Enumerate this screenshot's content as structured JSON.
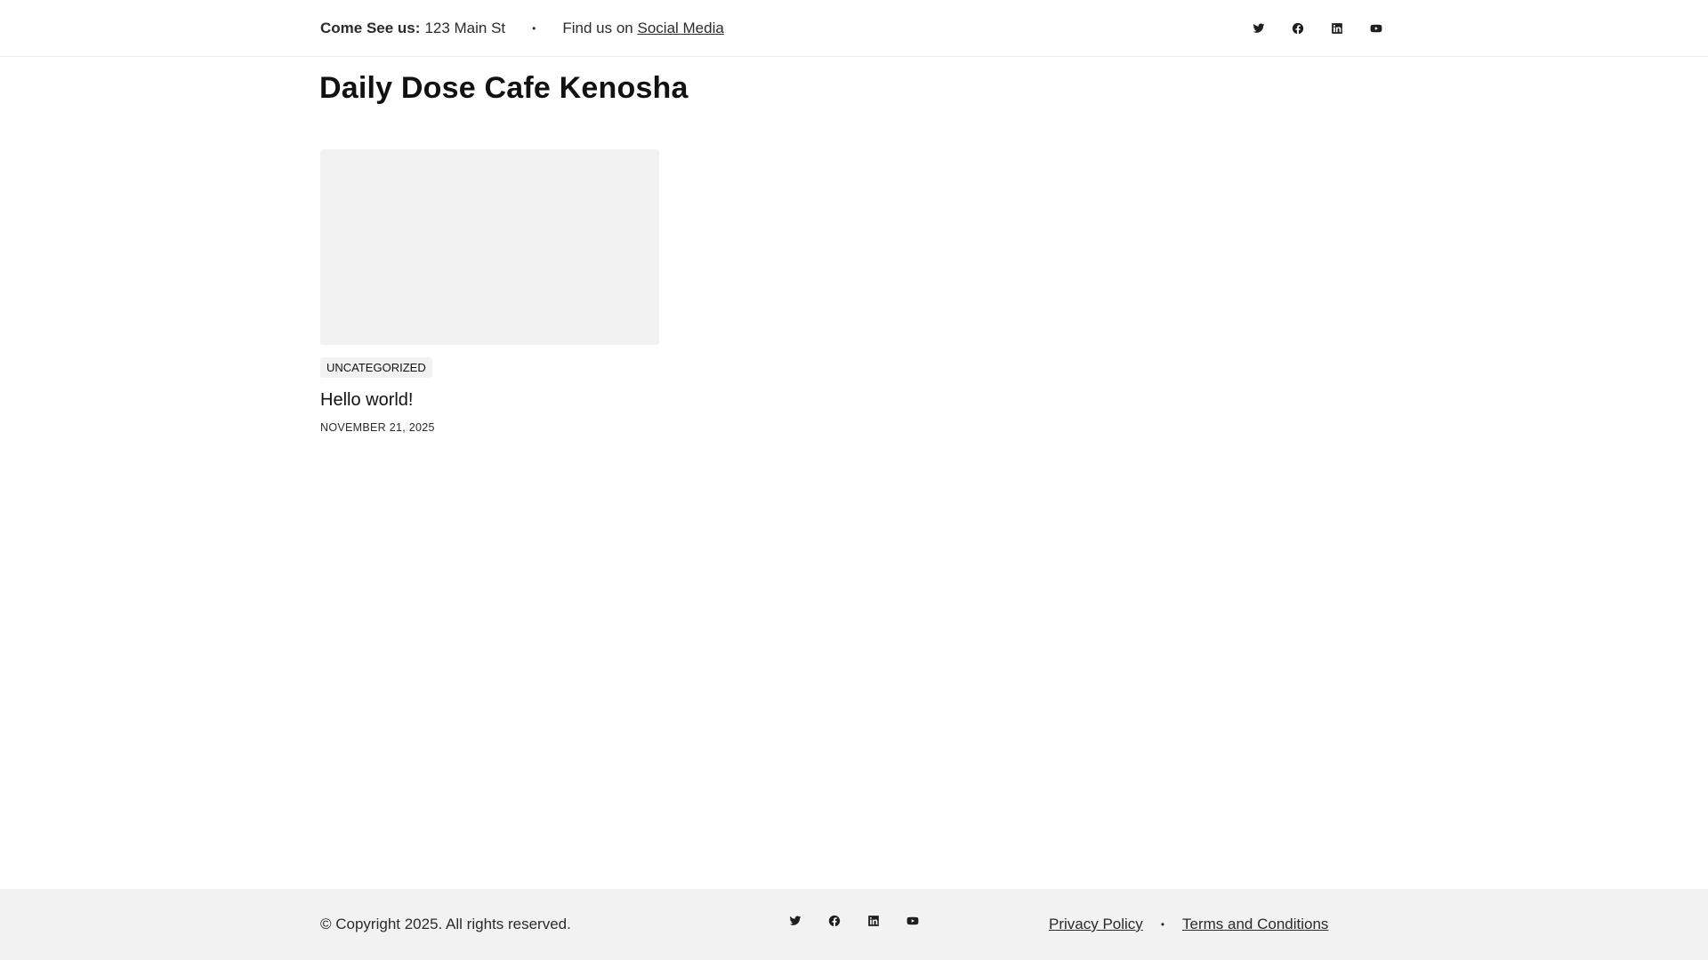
{
  "topbar": {
    "visit_label": "Come See us:",
    "address": "123 Main St",
    "separator": "•",
    "find_prefix": "Find us on",
    "social_link": "Social Media",
    "icons": [
      "twitter-icon",
      "facebook-icon",
      "linkedin-icon",
      "youtube-icon"
    ]
  },
  "site": {
    "title": "Daily Dose Cafe Kenosha"
  },
  "posts": [
    {
      "category": "UNCATEGORIZED",
      "title": "Hello world!",
      "date": "NOVEMBER 21, 2025"
    }
  ],
  "footer": {
    "copyright": "© Copyright 2025. All rights reserved.",
    "icons": [
      "twitter-icon",
      "facebook-icon",
      "linkedin-icon",
      "youtube-icon"
    ],
    "privacy_link": "Privacy Policy",
    "separator": "•",
    "terms_link": "Terms and Conditions"
  },
  "colors": {
    "text": "#1e1e1e",
    "muted_bg": "#f2f2f2",
    "border": "#ececec"
  }
}
